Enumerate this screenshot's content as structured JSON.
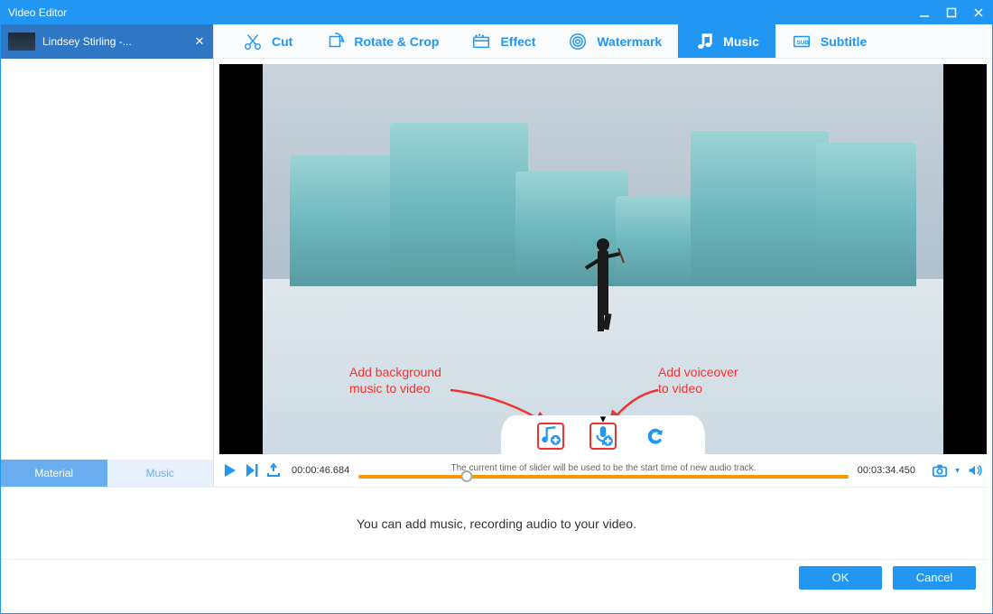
{
  "window": {
    "title": "Video Editor"
  },
  "file": {
    "name": "Lindsey Stirling -..."
  },
  "sidebar_tabs": [
    "Material",
    "Music"
  ],
  "tooltabs": [
    {
      "id": "cut",
      "label": "Cut"
    },
    {
      "id": "rotate",
      "label": "Rotate & Crop"
    },
    {
      "id": "effect",
      "label": "Effect"
    },
    {
      "id": "watermark",
      "label": "Watermark"
    },
    {
      "id": "music",
      "label": "Music",
      "active": true
    },
    {
      "id": "subtitle",
      "label": "Subtitle"
    }
  ],
  "annotations": {
    "bg_music": "Add background\nmusic to video",
    "voiceover": "Add voiceover\nto video"
  },
  "transport": {
    "current_time": "00:00:46.684",
    "total_time": "00:03:34.450",
    "hint": "The current time of slider will be used to be the start time of new audio track.",
    "playhead_pct": 22
  },
  "bottom_hint": "You can add music, recording audio to your video.",
  "footer": {
    "ok": "OK",
    "cancel": "Cancel"
  }
}
